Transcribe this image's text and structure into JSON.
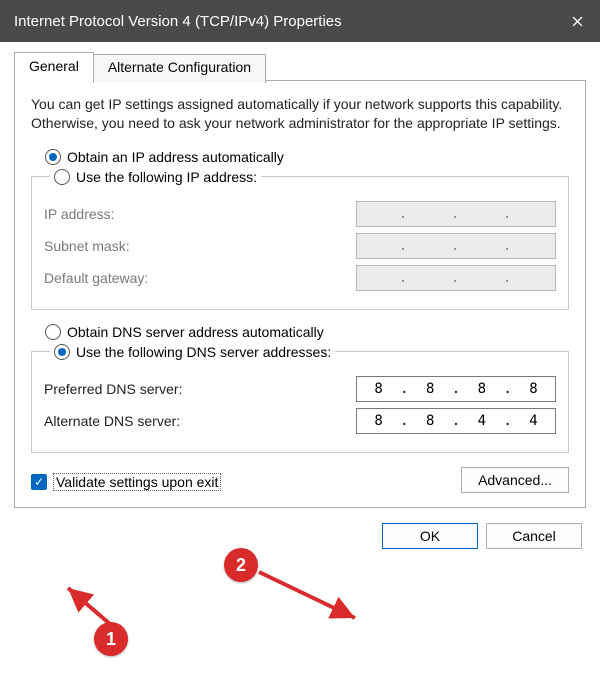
{
  "window": {
    "title": "Internet Protocol Version 4 (TCP/IPv4) Properties"
  },
  "tabs": {
    "general": "General",
    "alternate": "Alternate Configuration"
  },
  "intro": "You can get IP settings assigned automatically if your network supports this capability. Otherwise, you need to ask your network administrator for the appropriate IP settings.",
  "ip": {
    "auto_label": "Obtain an IP address automatically",
    "manual_label": "Use the following IP address:",
    "fields": {
      "ip_label": "IP address:",
      "subnet_label": "Subnet mask:",
      "gateway_label": "Default gateway:",
      "ip_value": [
        "",
        "",
        "",
        ""
      ],
      "subnet_value": [
        "",
        "",
        "",
        ""
      ],
      "gateway_value": [
        "",
        "",
        "",
        ""
      ]
    },
    "mode": "auto"
  },
  "dns": {
    "auto_label": "Obtain DNS server address automatically",
    "manual_label": "Use the following DNS server addresses:",
    "preferred_label": "Preferred DNS server:",
    "alternate_label": "Alternate DNS server:",
    "preferred_value": [
      "8",
      "8",
      "8",
      "8"
    ],
    "alternate_value": [
      "8",
      "8",
      "4",
      "4"
    ],
    "mode": "manual"
  },
  "validate_label": "Validate settings upon exit",
  "advanced_label": "Advanced...",
  "ok_label": "OK",
  "cancel_label": "Cancel",
  "annotations": {
    "badge1": "1",
    "badge2": "2"
  }
}
